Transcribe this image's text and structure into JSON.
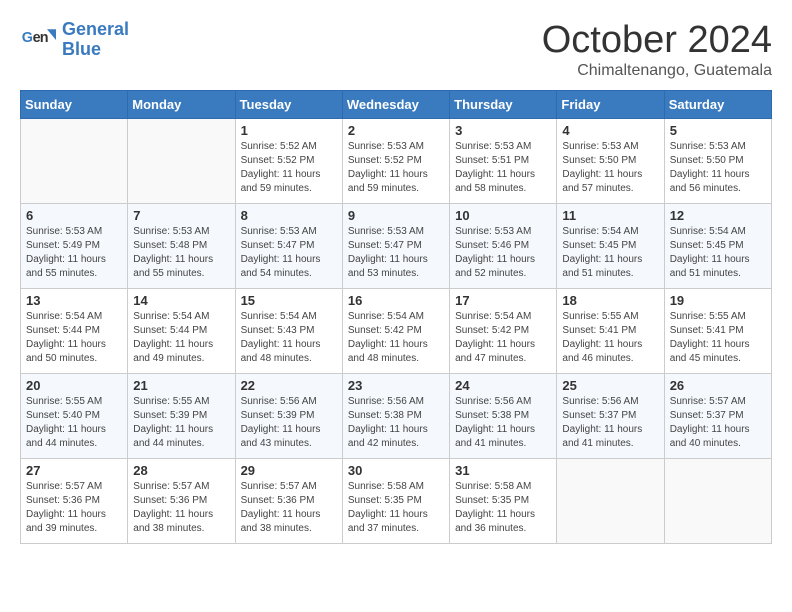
{
  "logo": {
    "line1": "General",
    "line2": "Blue"
  },
  "title": "October 2024",
  "subtitle": "Chimaltenango, Guatemala",
  "days_header": [
    "Sunday",
    "Monday",
    "Tuesday",
    "Wednesday",
    "Thursday",
    "Friday",
    "Saturday"
  ],
  "weeks": [
    [
      {
        "day": "",
        "info": ""
      },
      {
        "day": "",
        "info": ""
      },
      {
        "day": "1",
        "info": "Sunrise: 5:52 AM\nSunset: 5:52 PM\nDaylight: 11 hours\nand 59 minutes."
      },
      {
        "day": "2",
        "info": "Sunrise: 5:53 AM\nSunset: 5:52 PM\nDaylight: 11 hours\nand 59 minutes."
      },
      {
        "day": "3",
        "info": "Sunrise: 5:53 AM\nSunset: 5:51 PM\nDaylight: 11 hours\nand 58 minutes."
      },
      {
        "day": "4",
        "info": "Sunrise: 5:53 AM\nSunset: 5:50 PM\nDaylight: 11 hours\nand 57 minutes."
      },
      {
        "day": "5",
        "info": "Sunrise: 5:53 AM\nSunset: 5:50 PM\nDaylight: 11 hours\nand 56 minutes."
      }
    ],
    [
      {
        "day": "6",
        "info": "Sunrise: 5:53 AM\nSunset: 5:49 PM\nDaylight: 11 hours\nand 55 minutes."
      },
      {
        "day": "7",
        "info": "Sunrise: 5:53 AM\nSunset: 5:48 PM\nDaylight: 11 hours\nand 55 minutes."
      },
      {
        "day": "8",
        "info": "Sunrise: 5:53 AM\nSunset: 5:47 PM\nDaylight: 11 hours\nand 54 minutes."
      },
      {
        "day": "9",
        "info": "Sunrise: 5:53 AM\nSunset: 5:47 PM\nDaylight: 11 hours\nand 53 minutes."
      },
      {
        "day": "10",
        "info": "Sunrise: 5:53 AM\nSunset: 5:46 PM\nDaylight: 11 hours\nand 52 minutes."
      },
      {
        "day": "11",
        "info": "Sunrise: 5:54 AM\nSunset: 5:45 PM\nDaylight: 11 hours\nand 51 minutes."
      },
      {
        "day": "12",
        "info": "Sunrise: 5:54 AM\nSunset: 5:45 PM\nDaylight: 11 hours\nand 51 minutes."
      }
    ],
    [
      {
        "day": "13",
        "info": "Sunrise: 5:54 AM\nSunset: 5:44 PM\nDaylight: 11 hours\nand 50 minutes."
      },
      {
        "day": "14",
        "info": "Sunrise: 5:54 AM\nSunset: 5:44 PM\nDaylight: 11 hours\nand 49 minutes."
      },
      {
        "day": "15",
        "info": "Sunrise: 5:54 AM\nSunset: 5:43 PM\nDaylight: 11 hours\nand 48 minutes."
      },
      {
        "day": "16",
        "info": "Sunrise: 5:54 AM\nSunset: 5:42 PM\nDaylight: 11 hours\nand 48 minutes."
      },
      {
        "day": "17",
        "info": "Sunrise: 5:54 AM\nSunset: 5:42 PM\nDaylight: 11 hours\nand 47 minutes."
      },
      {
        "day": "18",
        "info": "Sunrise: 5:55 AM\nSunset: 5:41 PM\nDaylight: 11 hours\nand 46 minutes."
      },
      {
        "day": "19",
        "info": "Sunrise: 5:55 AM\nSunset: 5:41 PM\nDaylight: 11 hours\nand 45 minutes."
      }
    ],
    [
      {
        "day": "20",
        "info": "Sunrise: 5:55 AM\nSunset: 5:40 PM\nDaylight: 11 hours\nand 44 minutes."
      },
      {
        "day": "21",
        "info": "Sunrise: 5:55 AM\nSunset: 5:39 PM\nDaylight: 11 hours\nand 44 minutes."
      },
      {
        "day": "22",
        "info": "Sunrise: 5:56 AM\nSunset: 5:39 PM\nDaylight: 11 hours\nand 43 minutes."
      },
      {
        "day": "23",
        "info": "Sunrise: 5:56 AM\nSunset: 5:38 PM\nDaylight: 11 hours\nand 42 minutes."
      },
      {
        "day": "24",
        "info": "Sunrise: 5:56 AM\nSunset: 5:38 PM\nDaylight: 11 hours\nand 41 minutes."
      },
      {
        "day": "25",
        "info": "Sunrise: 5:56 AM\nSunset: 5:37 PM\nDaylight: 11 hours\nand 41 minutes."
      },
      {
        "day": "26",
        "info": "Sunrise: 5:57 AM\nSunset: 5:37 PM\nDaylight: 11 hours\nand 40 minutes."
      }
    ],
    [
      {
        "day": "27",
        "info": "Sunrise: 5:57 AM\nSunset: 5:36 PM\nDaylight: 11 hours\nand 39 minutes."
      },
      {
        "day": "28",
        "info": "Sunrise: 5:57 AM\nSunset: 5:36 PM\nDaylight: 11 hours\nand 38 minutes."
      },
      {
        "day": "29",
        "info": "Sunrise: 5:57 AM\nSunset: 5:36 PM\nDaylight: 11 hours\nand 38 minutes."
      },
      {
        "day": "30",
        "info": "Sunrise: 5:58 AM\nSunset: 5:35 PM\nDaylight: 11 hours\nand 37 minutes."
      },
      {
        "day": "31",
        "info": "Sunrise: 5:58 AM\nSunset: 5:35 PM\nDaylight: 11 hours\nand 36 minutes."
      },
      {
        "day": "",
        "info": ""
      },
      {
        "day": "",
        "info": ""
      }
    ]
  ]
}
